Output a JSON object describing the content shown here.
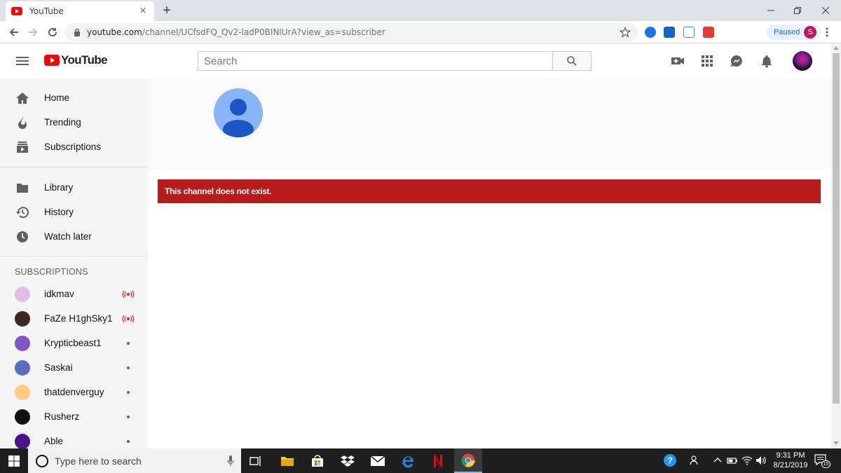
{
  "browser": {
    "tab_title": "YouTube",
    "tab_close": "×",
    "new_tab": "+",
    "url_domain": "youtube.com",
    "url_path": "/channel/UCfsdFQ_Qv2-ladP0BINlUrA?view_as=subscriber",
    "profile_status": "Paused",
    "profile_initial": "S"
  },
  "masthead": {
    "logo_text": "YouTube",
    "search_placeholder": "Search"
  },
  "sidebar": {
    "main_items": [
      {
        "label": "Home",
        "icon": "home-icon"
      },
      {
        "label": "Trending",
        "icon": "trending-icon"
      },
      {
        "label": "Subscriptions",
        "icon": "subscriptions-icon"
      }
    ],
    "library_items": [
      {
        "label": "Library",
        "icon": "library-icon"
      },
      {
        "label": "History",
        "icon": "history-icon"
      },
      {
        "label": "Watch later",
        "icon": "watch-later-icon"
      }
    ],
    "subscriptions_heading": "SUBSCRIPTIONS",
    "subscriptions": [
      {
        "name": "idkmav",
        "status": "live",
        "avatar_color": "#e1bee7"
      },
      {
        "name": "FaZe H1ghSky1",
        "status": "live",
        "avatar_color": "#3e2723"
      },
      {
        "name": "Krypticbeast1",
        "status": "new",
        "avatar_color": "#7e57c2"
      },
      {
        "name": "Saskai",
        "status": "new",
        "avatar_color": "#5c6bc0"
      },
      {
        "name": "thatdenverguy",
        "status": "new",
        "avatar_color": "#ffcc80"
      },
      {
        "name": "Rusherz",
        "status": "new",
        "avatar_color": "#111111"
      },
      {
        "name": "Able",
        "status": "new",
        "avatar_color": "#4a148c"
      }
    ]
  },
  "main": {
    "error_message": "This channel does not exist."
  },
  "taskbar": {
    "search_placeholder": "Type here to search",
    "time": "9:31 PM",
    "date": "8/21/2019",
    "notification_count": "15"
  },
  "colors": {
    "youtube_red": "#ff0000",
    "error_red": "#b71c1c",
    "sidebar_bg": "#f5f5f5",
    "live_red": "#e62117",
    "new_dot_blue": "#1976d2"
  }
}
